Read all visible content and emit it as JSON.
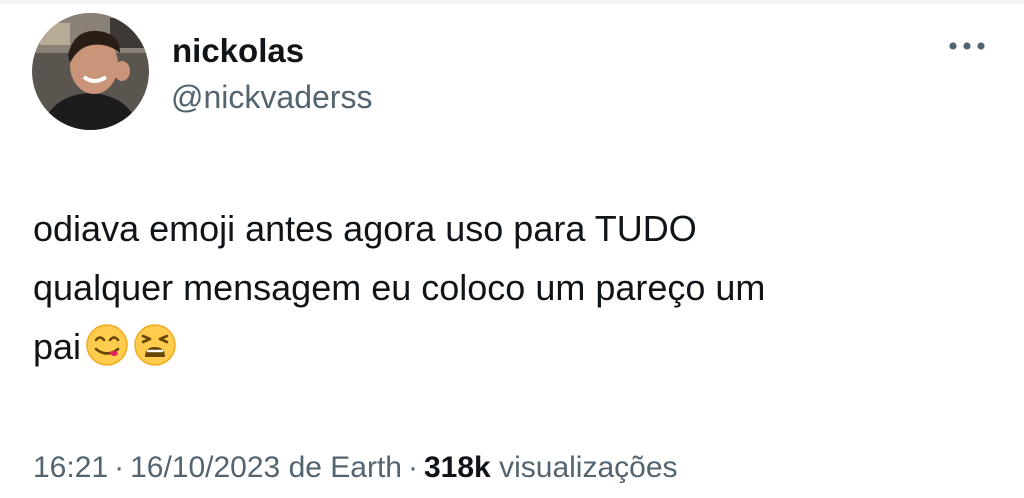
{
  "author": {
    "display_name": "nickolas",
    "handle": "@nickvaderss",
    "avatar_icon": "profile-photo"
  },
  "actions": {
    "more_icon": "more-horizontal-icon"
  },
  "tweet": {
    "text_line_1": "odiava emoji antes agora uso para TUDO",
    "text_line_2": "qualquer mensagem eu coloco um pareço um",
    "text_line_3": "pai",
    "emojis": [
      "face-savoring-food-emoji",
      "tired-face-emoji"
    ]
  },
  "meta": {
    "time": "16:21",
    "date": "16/10/2023",
    "source": "de Earth",
    "separator": "·",
    "views_count": "318k",
    "views_label": "visualizações"
  },
  "colors": {
    "text_primary": "#0f1419",
    "text_secondary": "#536471",
    "emoji_yellow": "#ffcc4d"
  }
}
